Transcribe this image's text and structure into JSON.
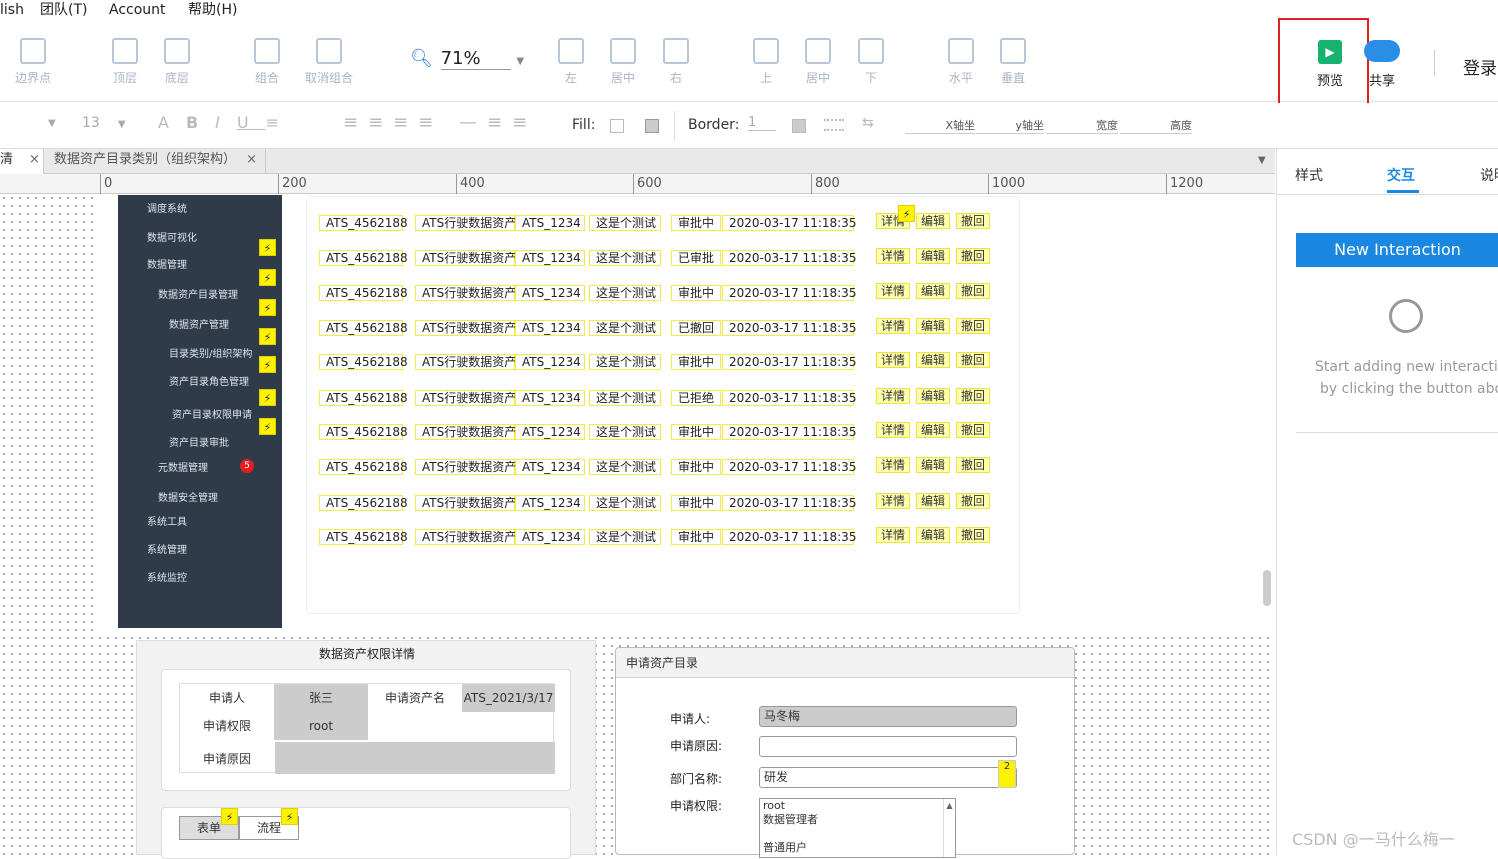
{
  "menu": {
    "items": [
      "lish",
      "团队(T)",
      "Account",
      "帮助(H)"
    ]
  },
  "toolbar": {
    "tools": [
      "边界点",
      "顶层",
      "底层",
      "组合",
      "取消组合",
      "左",
      "居中",
      "右",
      "上",
      "居中",
      "下",
      "水平",
      "垂直"
    ],
    "zoom": "71%",
    "preview": "预览",
    "share": "共享",
    "login": "登录"
  },
  "format": {
    "font_size": "13",
    "fill_label": "Fill:",
    "border_label": "Border:",
    "border_value": "1",
    "x_label": "X轴坐",
    "y_label": "y轴坐",
    "w_label": "宽度",
    "h_label": "高度"
  },
  "tabs": {
    "tab1": "清",
    "tab2": "数据资产目录类别（组织架构）"
  },
  "ruler": {
    "marks": [
      "0",
      "200",
      "400",
      "600",
      "800",
      "1000",
      "1200"
    ]
  },
  "right_panel": {
    "tabs": [
      "样式",
      "交互",
      "说明"
    ],
    "active_tab": "交互",
    "new_button": "New Interaction",
    "hint_line1": "Start adding new interactio",
    "hint_line2": "by clicking the button abov"
  },
  "sidenav": {
    "items": [
      "调度系统",
      "数据可视化",
      "数据管理",
      "数据资产目录管理",
      "数据资产管理",
      "目录类别/组织架构",
      "资产目录角色管理",
      "资产目录权限申请",
      "资产目录审批",
      "元数据管理",
      "数据安全管理",
      "系统工具",
      "系统管理",
      "系统监控"
    ],
    "badge": "5"
  },
  "table": {
    "rows": [
      {
        "id": "ATS_4562188",
        "name": "ATS行驶数据资产",
        "code": "ATS_1234",
        "desc": "这是个测试",
        "status": "审批中",
        "time": "2020-03-17 11:18:35"
      },
      {
        "id": "ATS_4562188",
        "name": "ATS行驶数据资产",
        "code": "ATS_1234",
        "desc": "这是个测试",
        "status": "已审批",
        "time": "2020-03-17 11:18:35"
      },
      {
        "id": "ATS_4562188",
        "name": "ATS行驶数据资产",
        "code": "ATS_1234",
        "desc": "这是个测试",
        "status": "审批中",
        "time": "2020-03-17 11:18:35"
      },
      {
        "id": "ATS_4562188",
        "name": "ATS行驶数据资产",
        "code": "ATS_1234",
        "desc": "这是个测试",
        "status": "已撤回",
        "time": "2020-03-17 11:18:35"
      },
      {
        "id": "ATS_4562188",
        "name": "ATS行驶数据资产",
        "code": "ATS_1234",
        "desc": "这是个测试",
        "status": "审批中",
        "time": "2020-03-17 11:18:35"
      },
      {
        "id": "ATS_4562188",
        "name": "ATS行驶数据资产",
        "code": "ATS_1234",
        "desc": "这是个测试",
        "status": "已拒绝",
        "time": "2020-03-17 11:18:35"
      },
      {
        "id": "ATS_4562188",
        "name": "ATS行驶数据资产",
        "code": "ATS_1234",
        "desc": "这是个测试",
        "status": "审批中",
        "time": "2020-03-17 11:18:35"
      },
      {
        "id": "ATS_4562188",
        "name": "ATS行驶数据资产",
        "code": "ATS_1234",
        "desc": "这是个测试",
        "status": "审批中",
        "time": "2020-03-17 11:18:35"
      },
      {
        "id": "ATS_4562188",
        "name": "ATS行驶数据资产",
        "code": "ATS_1234",
        "desc": "这是个测试",
        "status": "审批中",
        "time": "2020-03-17 11:18:35"
      },
      {
        "id": "ATS_4562188",
        "name": "ATS行驶数据资产",
        "code": "ATS_1234",
        "desc": "这是个测试",
        "status": "审批中",
        "time": "2020-03-17 11:18:35"
      }
    ],
    "actions": [
      "详情",
      "编辑",
      "撤回"
    ]
  },
  "detail": {
    "title": "数据资产权限详情",
    "applicant_label": "申请人",
    "applicant": "张三",
    "asset_label": "申请资产名",
    "asset": "ATS_2021/3/17",
    "perm_label": "申请权限",
    "perm": "root",
    "reason_label": "申请原因",
    "tab_form": "表单",
    "tab_flow": "流程"
  },
  "apply": {
    "title": "申请资产目录",
    "applicant_label": "申请人:",
    "applicant": "马冬梅",
    "reason_label": "申请原因:",
    "dept_label": "部门名称:",
    "dept": "研发",
    "dept_badge": "2",
    "perm_label": "申请权限:",
    "perm_options": [
      "root",
      "数据管理者",
      "",
      "普通用户"
    ]
  },
  "watermark": "CSDN @一马什么梅一"
}
